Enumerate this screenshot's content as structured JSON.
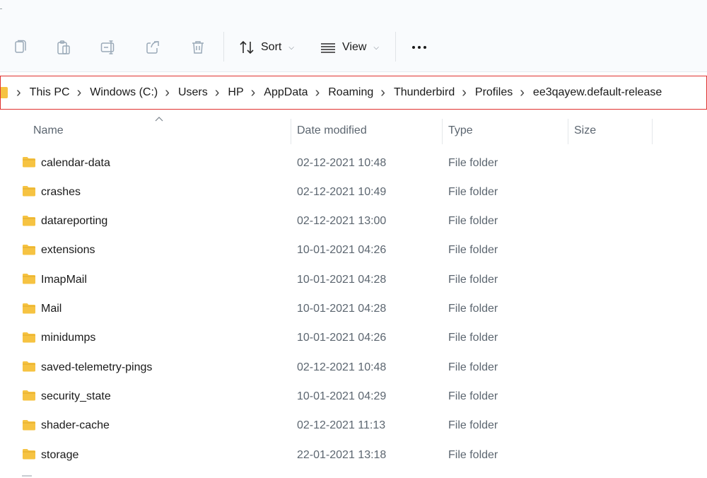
{
  "toolbar": {
    "copy_icon": "copy-icon",
    "paste_icon": "paste-icon",
    "rename_icon": "rename-icon",
    "share_icon": "share-icon",
    "delete_icon": "trash-icon",
    "sort_label": "Sort",
    "view_label": "View",
    "more_icon": "ellipsis-icon"
  },
  "address": {
    "crumbs": [
      "This PC",
      "Windows (C:)",
      "Users",
      "HP",
      "AppData",
      "Roaming",
      "Thunderbird",
      "Profiles",
      "ee3qayew.default-release"
    ],
    "highlight_color": "#e0312f"
  },
  "columns": {
    "name": "Name",
    "date": "Date modified",
    "type": "Type",
    "size": "Size"
  },
  "files": [
    {
      "name": "calendar-data",
      "date": "02-12-2021 10:48",
      "type": "File folder"
    },
    {
      "name": "crashes",
      "date": "02-12-2021 10:49",
      "type": "File folder"
    },
    {
      "name": "datareporting",
      "date": "02-12-2021 13:00",
      "type": "File folder"
    },
    {
      "name": "extensions",
      "date": "10-01-2021 04:26",
      "type": "File folder"
    },
    {
      "name": "ImapMail",
      "date": "10-01-2021 04:28",
      "type": "File folder"
    },
    {
      "name": "Mail",
      "date": "10-01-2021 04:28",
      "type": "File folder"
    },
    {
      "name": "minidumps",
      "date": "10-01-2021 04:26",
      "type": "File folder"
    },
    {
      "name": "saved-telemetry-pings",
      "date": "02-12-2021 10:48",
      "type": "File folder"
    },
    {
      "name": "security_state",
      "date": "10-01-2021 04:29",
      "type": "File folder"
    },
    {
      "name": "shader-cache",
      "date": "02-12-2021 11:13",
      "type": "File folder"
    },
    {
      "name": "storage",
      "date": "22-01-2021 13:18",
      "type": "File folder"
    }
  ],
  "colors": {
    "folder": "#f6c342",
    "folder_dark": "#e3ab2a",
    "icon_gray": "#9aa9b8"
  }
}
